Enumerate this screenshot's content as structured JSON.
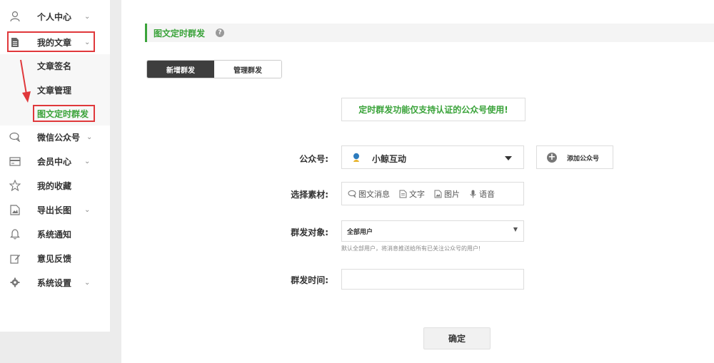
{
  "sidebar": {
    "items": [
      {
        "label": "个人中心",
        "icon": "user-icon"
      },
      {
        "label": "我的文章",
        "icon": "document-icon"
      },
      {
        "label": "微信公众号",
        "icon": "chat-icon"
      },
      {
        "label": "会员中心",
        "icon": "card-icon"
      },
      {
        "label": "我的收藏",
        "icon": "star-icon"
      },
      {
        "label": "导出长图",
        "icon": "image-icon"
      },
      {
        "label": "系统通知",
        "icon": "bell-icon"
      },
      {
        "label": "意见反馈",
        "icon": "edit-icon"
      },
      {
        "label": "系统设置",
        "icon": "gear-icon"
      }
    ],
    "submenu": [
      {
        "label": "文章签名"
      },
      {
        "label": "文章管理"
      },
      {
        "label": "图文定时群发"
      }
    ],
    "caret": "⌄"
  },
  "main": {
    "title": "图文定时群发",
    "tabs": [
      {
        "label": "新增群发"
      },
      {
        "label": "管理群发"
      }
    ],
    "notice": "定时群发功能仅支持认证的公众号使用!",
    "form": {
      "account_label": "公众号:",
      "account_value": "小鲸互动",
      "add_account_label": "添加公众号",
      "material_label": "选择素材:",
      "material_options": [
        {
          "label": "图文消息",
          "icon": "chat-bubble-icon"
        },
        {
          "label": "文字",
          "icon": "text-file-icon"
        },
        {
          "label": "图片",
          "icon": "picture-icon"
        },
        {
          "label": "语音",
          "icon": "microphone-icon"
        }
      ],
      "target_label": "群发对象:",
      "target_value": "全部用户",
      "target_hint": "默认全部用户，将消息推送给所有已关注公众号的用户!",
      "time_label": "群发时间:",
      "time_value": ""
    },
    "confirm_label": "确定"
  },
  "colors": {
    "accent_green": "#3aa33a",
    "highlight_red": "#e0383b",
    "tab_active": "#3e3e3e"
  }
}
